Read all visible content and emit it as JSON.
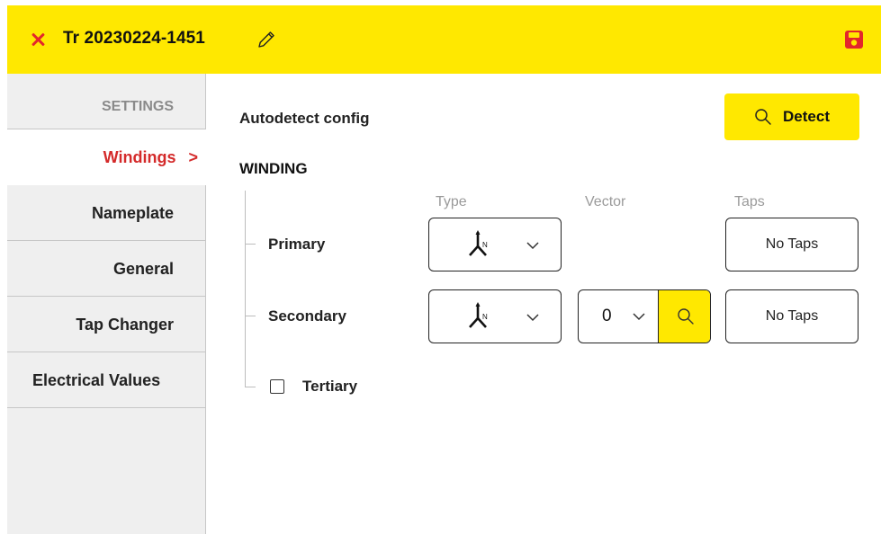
{
  "header": {
    "title": "Tr 20230224-1451",
    "close_icon": "close-icon",
    "edit_icon": "pencil-icon",
    "save_icon": "save-icon",
    "colors": {
      "bar": "#ffe800",
      "close": "#e3262b",
      "save": "#e3262b"
    }
  },
  "sidebar": {
    "section_label": "SETTINGS",
    "items": [
      {
        "label": "Windings",
        "active": true
      },
      {
        "label": "Nameplate",
        "active": false
      },
      {
        "label": "General",
        "active": false
      },
      {
        "label": "Tap Changer",
        "active": false
      },
      {
        "label": "Electrical Values",
        "active": false
      }
    ],
    "active_chevron": ">",
    "active_color": "#d42a2a"
  },
  "main": {
    "autodetect_label": "Autodetect config",
    "detect_button": {
      "label": "Detect",
      "icon": "search-icon"
    },
    "winding_heading": "WINDING",
    "columns": {
      "type": "Type",
      "vector": "Vector",
      "taps": "Taps"
    },
    "rows": {
      "primary": {
        "label": "Primary",
        "type_icon": "wye-neutral-icon",
        "taps": "No Taps"
      },
      "secondary": {
        "label": "Secondary",
        "type_icon": "wye-neutral-icon",
        "vector": "0",
        "taps": "No Taps"
      },
      "tertiary": {
        "label": "Tertiary",
        "checked": false
      }
    }
  }
}
